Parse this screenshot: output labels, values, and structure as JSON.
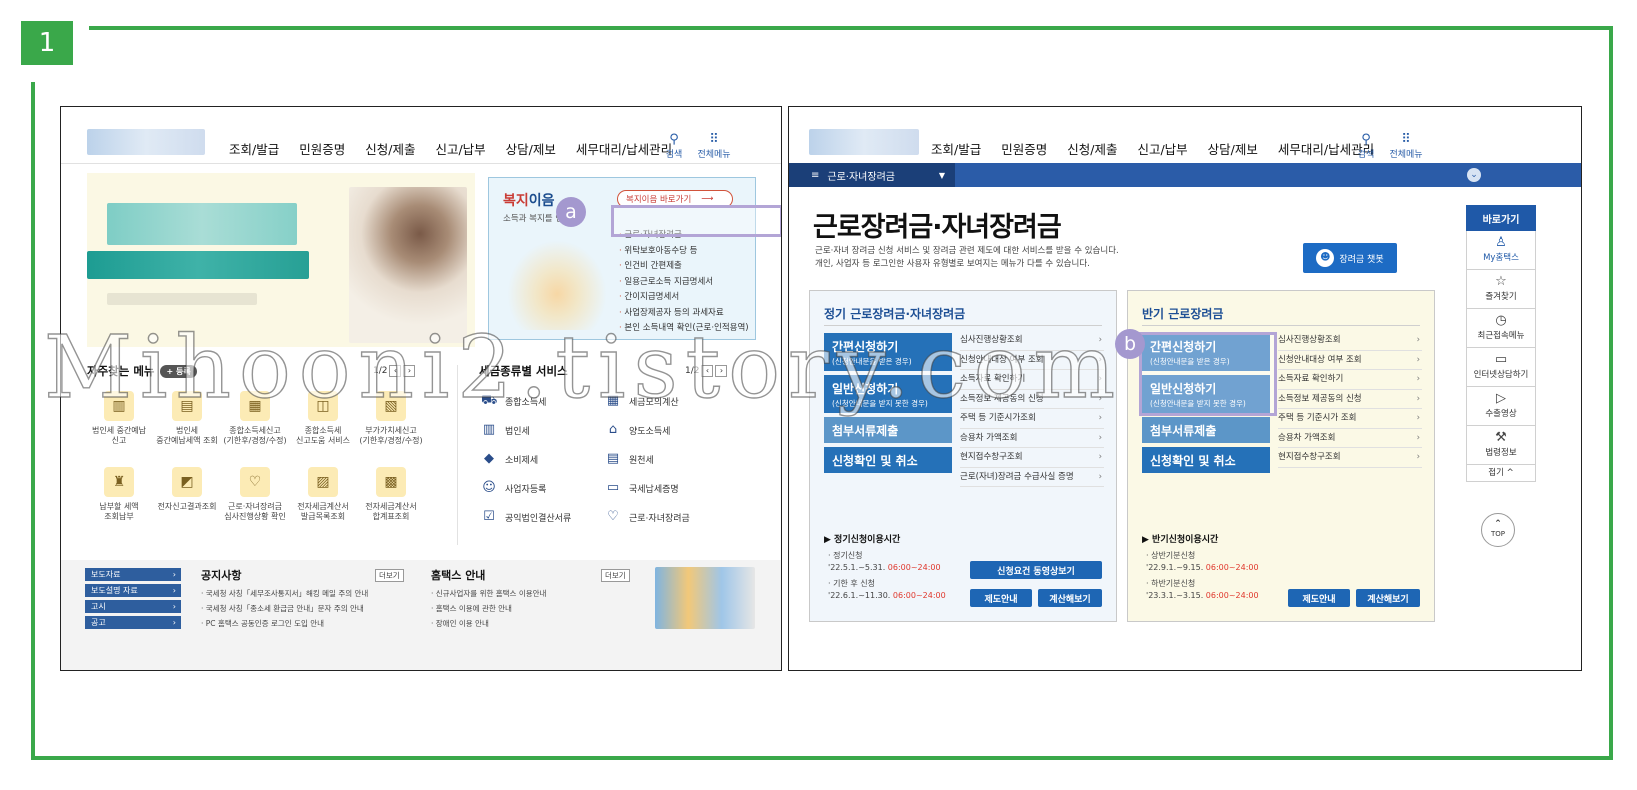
{
  "step": "1",
  "watermark": "Mihooni2.tistory.com",
  "colors": {
    "frame": "#3aa84a",
    "nav_blue": "#2b5ca8",
    "button_blue": "#2571b8",
    "highlight": "#b3a5d6",
    "time_red": "#e0382d"
  },
  "shotA": {
    "nav": [
      "조회/발급",
      "민원증명",
      "신청/제출",
      "신고/납부",
      "상담/제보",
      "세무대리/납세관리"
    ],
    "search_label": "검색",
    "menu_label": "전체메뉴",
    "welfare": {
      "title_highlight": "복지",
      "title_rest": "이음",
      "subtitle": "소득과 복지를 연결",
      "goto_label": "복지이음 바로가기",
      "goto_arrow": "⟶",
      "items": [
        "근로·자녀장려금",
        "위탁보호아동수당 등",
        "인건비 간편제출",
        "일용근로소득 지급명세서",
        "간이지급명세서",
        "사업장제공자 등의 과세자료",
        "본인 소득내역 확인(근로·인적용역)"
      ],
      "marker": "a"
    },
    "favorites": {
      "title": "자주찾는 메뉴",
      "more": "+ 등록",
      "pager": "1/2",
      "items": [
        {
          "icon": "building-icon",
          "glyph": "▥",
          "l1": "법인세 중간예납",
          "l2": "신고"
        },
        {
          "icon": "document-icon",
          "glyph": "▤",
          "l1": "법인세",
          "l2": "중간예납세액 조회"
        },
        {
          "icon": "calendar-icon",
          "glyph": "▦",
          "l1": "종합소득세신고",
          "l2": "(기한후/경정/수정)"
        },
        {
          "icon": "report-icon",
          "glyph": "◫",
          "l1": "종합소득세",
          "l2": "신고도움 서비스"
        },
        {
          "icon": "vat-icon",
          "glyph": "▧",
          "l1": "부가가치세신고",
          "l2": "(기한후/경정/수정)"
        },
        {
          "icon": "moneybag-icon",
          "glyph": "♜",
          "l1": "납부할 세액",
          "l2": "조회납부"
        },
        {
          "icon": "e-report-icon",
          "glyph": "◩",
          "l1": "전자신고결과조회",
          "l2": ""
        },
        {
          "icon": "heart-hand-icon",
          "glyph": "♡",
          "l1": "근로·자녀장려금",
          "l2": "심사진행상황 확인"
        },
        {
          "icon": "invoice-icon",
          "glyph": "▨",
          "l1": "전자세금계산서",
          "l2": "발급목록조회"
        },
        {
          "icon": "invoice-sum-icon",
          "glyph": "▩",
          "l1": "전자세금계산서",
          "l2": "합계표조회"
        }
      ]
    },
    "tax_services": {
      "title": "세금종류별 서비스",
      "pager": "1/2",
      "left": [
        {
          "icon": "car-icon",
          "glyph": "⛟",
          "label": "종합소득세"
        },
        {
          "icon": "building-icon",
          "glyph": "▥",
          "label": "법인세"
        },
        {
          "icon": "diamond-icon",
          "glyph": "◆",
          "label": "소비제세"
        },
        {
          "icon": "person-icon",
          "glyph": "☺",
          "label": "사업자등록"
        },
        {
          "icon": "clipboard-icon",
          "glyph": "☑",
          "label": "공익법인결산서류"
        }
      ],
      "right": [
        {
          "icon": "calculator-icon",
          "glyph": "▦",
          "label": "세금모의계산"
        },
        {
          "icon": "house-icon",
          "glyph": "⌂",
          "label": "양도소득세"
        },
        {
          "icon": "table-icon",
          "glyph": "▤",
          "label": "원천세"
        },
        {
          "icon": "certificate-icon",
          "glyph": "▭",
          "label": "국세납세증명"
        },
        {
          "icon": "heart-icon",
          "glyph": "♡",
          "label": "근로·자녀장려금"
        }
      ]
    },
    "press": [
      "보도자료",
      "보도설명 자료",
      "고시",
      "공고"
    ],
    "notice": {
      "title": "공지사항",
      "more": "더보기",
      "items": [
        "국세청 사칭「세무조사통지서」해킹 메일 주의 안내",
        "국세청 사칭「종소세 환급금 안내」문자 주의 안내",
        "PC 홈택스 공동인증 로그인 도입 안내"
      ]
    },
    "hometax": {
      "title": "홈택스 안내",
      "more": "더보기",
      "items": [
        "신규사업자를 위한 홈택스 이용안내",
        "홈택스 이용에 관한 안내",
        "장애인 이용 안내"
      ]
    }
  },
  "shotB": {
    "nav": [
      "조회/발급",
      "민원증명",
      "신청/제출",
      "신고/납부",
      "상담/제보",
      "세무대리/납세관리"
    ],
    "search_label": "검색",
    "menu_label": "전체메뉴",
    "menu_tab": "근로·자녀장려금",
    "title": "근로장려금·자녀장려금",
    "desc1": "근로·자녀 장려금 신청 서비스 및 장려금 관련 제도에 대한 서비스를 받을 수 있습니다.",
    "desc2": "개인, 사업자 등 로그인한 사용자 유형별로 보여지는 메뉴가 다를 수 있습니다.",
    "mascot_btn": "장려금 챗봇",
    "regular": {
      "title": "정기 근로장려금·자녀장려금",
      "btn_simple": "간편신청하기",
      "btn_simple_sub": "(신청안내문을 받은 경우)",
      "btn_general": "일반신청하기",
      "btn_general_sub": "(신청안내문을 받지 못한 경우)",
      "btn_docs": "첨부서류제출",
      "btn_cancel": "신청확인 및 취소",
      "list": [
        "심사진행상황조회",
        "신청안내대상 여부 조회",
        "소득자료 확인하기",
        "소득정보 제공동의 신청",
        "주택 등 기준시가조회",
        "승용차 가액조회",
        "현지접수창구조회",
        "근로(자녀)장려금 수급사실 증명"
      ],
      "time_title": "▶ 정기신청이용시간",
      "row1_label": "· 정기신청",
      "row1_date": "'22.5.1.~5.31.",
      "row1_time": "06:00~24:00",
      "row2_label": "· 기한 후 신청",
      "row2_date": "'22.6.1.~11.30.",
      "row2_time": "06:00~24:00",
      "btn_video": "신청요건 동영상보기",
      "btn_guide": "제도안내",
      "btn_calc": "계산해보기"
    },
    "half": {
      "title": "반기 근로장려금",
      "btn_simple": "간편신청하기",
      "btn_simple_sub": "(신청안내문을 받은 경우)",
      "btn_general": "일반신청하기",
      "btn_general_sub": "(신청안내문을 받지 못한 경우)",
      "btn_docs": "첨부서류제출",
      "btn_cancel": "신청확인 및 취소",
      "list": [
        "심사진행상황조회",
        "신청안내대상 여부 조회",
        "소득자료 확인하기",
        "소득정보 제공동의 신청",
        "주택 등 기준시가 조회",
        "승용차 가액조회",
        "현지접수창구조회"
      ],
      "time_title": "▶ 반기신청이용시간",
      "row1_label": "· 상반기분신청",
      "row1_date": "'22.9.1.~9.15.",
      "row1_time": "06:00~24:00",
      "row2_label": "· 하반기분신청",
      "row2_date": "'23.3.1.~3.15.",
      "row2_time": "06:00~24:00",
      "btn_guide": "제도안내",
      "btn_calc": "계산해보기",
      "marker": "b"
    },
    "quick": {
      "title": "바로가기",
      "items": [
        {
          "icon": "user-icon",
          "glyph": "♙",
          "label": "My홈택스"
        },
        {
          "icon": "star-icon",
          "glyph": "☆",
          "label": "즐겨찾기"
        },
        {
          "icon": "recent-icon",
          "glyph": "◷",
          "label": "최근접속메뉴"
        },
        {
          "icon": "monitor-icon",
          "glyph": "▭",
          "label": "인터넷상담하기"
        },
        {
          "icon": "play-icon",
          "glyph": "▷",
          "label": "수출영상"
        },
        {
          "icon": "gavel-icon",
          "glyph": "⚒",
          "label": "법령정보"
        }
      ],
      "fold": "접기 ^",
      "top_glyph": "⌃",
      "top_label": "TOP"
    }
  }
}
